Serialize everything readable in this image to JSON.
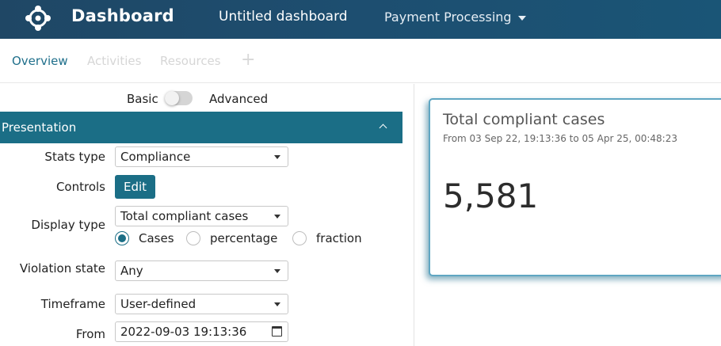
{
  "header": {
    "brand": "Dashboard",
    "dashboard_title": "Untitled dashboard",
    "process": "Payment Processing",
    "logo_icon": "network-diamond-icon"
  },
  "tabs": [
    {
      "label": "Overview",
      "active": true
    },
    {
      "label": "Activities",
      "active": false
    },
    {
      "label": "Resources",
      "active": false
    },
    {
      "label": "+",
      "active": false
    }
  ],
  "mode": {
    "basic": "Basic",
    "advanced": "Advanced",
    "advanced_on": false
  },
  "section": {
    "title": "Presentation",
    "chevron_icon": "chevron-up-icon"
  },
  "form": {
    "stats_type": {
      "label": "Stats type",
      "value": "Compliance"
    },
    "controls": {
      "label": "Controls",
      "button": "Edit"
    },
    "display_type": {
      "label": "Display type",
      "value": "Total compliant cases",
      "options": [
        {
          "label": "Cases",
          "selected": true
        },
        {
          "label": "percentage",
          "selected": false
        },
        {
          "label": "fraction",
          "selected": false
        }
      ]
    },
    "violation_state": {
      "label": "Violation state",
      "value": "Any"
    },
    "timeframe": {
      "label": "Timeframe",
      "value": "User-defined"
    },
    "from": {
      "label": "From",
      "value": "2022-09-03 19:13:36",
      "icon": "calendar-icon"
    }
  },
  "card": {
    "title": "Total compliant cases",
    "subtitle": "From 03 Sep 22, 19:13:36 to 05 Apr 25, 00:48:23",
    "value": "5,581"
  },
  "colors": {
    "accent": "#1b6e86",
    "header": "#1d4e70"
  }
}
